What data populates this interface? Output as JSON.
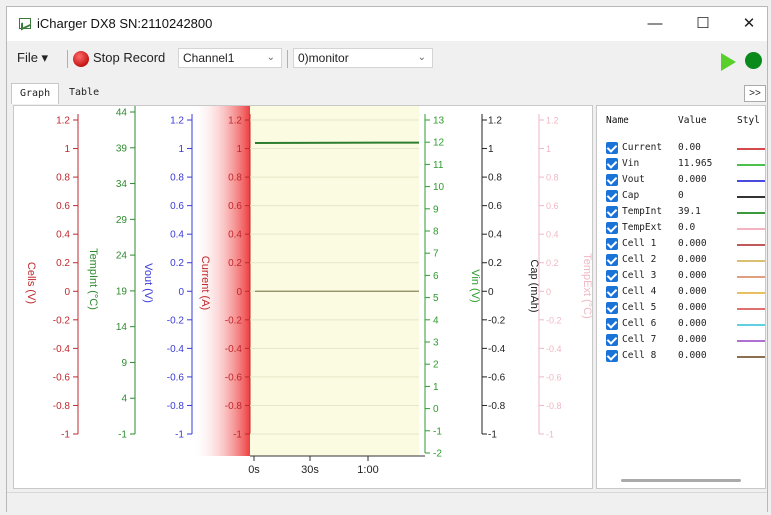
{
  "window": {
    "title": "iCharger DX8 SN:2110242800",
    "minimize_glyph": "—",
    "maximize_glyph": "☐",
    "close_glyph": "✕"
  },
  "toolbar": {
    "file_label": "File ▾",
    "stop_record_label": "Stop Record",
    "channel_value": "Channel1",
    "monitor_value": "0)monitor"
  },
  "tabs": [
    {
      "label": "Graph",
      "active": true
    },
    {
      "label": "Table",
      "active": false
    }
  ],
  "expand_label": ">>",
  "chart_data": {
    "type": "line",
    "x_ticks": [
      "0s",
      "30s",
      "1:00"
    ],
    "axes": [
      {
        "name": "cells",
        "label": "Cells (V)",
        "color": "#c0282d",
        "ticks": [
          "1.2",
          "1",
          "0.8",
          "0.6",
          "0.4",
          "0.2",
          "0",
          "-0.2",
          "-0.4",
          "-0.6",
          "-0.8",
          "-1"
        ]
      },
      {
        "name": "tempint",
        "label": "TempInt (°C)",
        "color": "#2f8a2f",
        "ticks": [
          "44",
          "39",
          "34",
          "29",
          "24",
          "19",
          "14",
          "9",
          "4",
          "-1"
        ]
      },
      {
        "name": "vout",
        "label": "Vout (V)",
        "color": "#3a3ad8",
        "ticks": [
          "1.2",
          "1",
          "0.8",
          "0.6",
          "0.4",
          "0.2",
          "0",
          "-0.2",
          "-0.4",
          "-0.6",
          "-0.8",
          "-1"
        ]
      },
      {
        "name": "current",
        "label": "Current (A)",
        "color": "#c0282d",
        "ticks": [
          "1.2",
          "1",
          "0.8",
          "0.6",
          "0.4",
          "0.2",
          "0",
          "-0.2",
          "-0.4",
          "-0.6",
          "-0.8",
          "-1"
        ]
      },
      {
        "name": "vin",
        "label": "Vin (V)",
        "color": "#2e9c2e",
        "ticks": [
          "13",
          "12",
          "11",
          "10",
          "9",
          "8",
          "7",
          "6",
          "5",
          "4",
          "3",
          "2",
          "1",
          "0",
          "-1",
          "-2"
        ]
      },
      {
        "name": "cap",
        "label": "Cap (mAh)",
        "color": "#222222",
        "ticks": [
          "1.2",
          "1",
          "0.8",
          "0.6",
          "0.4",
          "0.2",
          "0",
          "-0.2",
          "-0.4",
          "-0.6",
          "-0.8",
          "-1"
        ]
      },
      {
        "name": "tempext",
        "label": "TempExt (°C)",
        "color": "#f0b7c4",
        "ticks": [
          "1.2",
          "1",
          "0.8",
          "0.6",
          "0.4",
          "0.2",
          "0",
          "-0.2",
          "-0.4",
          "-0.6",
          "-0.8",
          "-1"
        ]
      }
    ],
    "series": [
      {
        "name": "Vin",
        "color": "#2e7d2e",
        "value": 11.965
      },
      {
        "name": "Current",
        "color": "#8a8a5a",
        "value": 0.0
      }
    ]
  },
  "panel": {
    "headers": [
      "Name",
      "Value",
      "Styl"
    ],
    "rows": [
      {
        "name": "Current",
        "value": "0.00",
        "color": "#d44a4a"
      },
      {
        "name": "Vin",
        "value": "11.965",
        "color": "#4cbf4c"
      },
      {
        "name": "Vout",
        "value": "0.000",
        "color": "#4a4ae0"
      },
      {
        "name": "Cap",
        "value": "0",
        "color": "#333333"
      },
      {
        "name": "TempInt",
        "value": "39.1",
        "color": "#3a9a3a"
      },
      {
        "name": "TempExt",
        "value": "0.0",
        "color": "#f2b4c2"
      },
      {
        "name": "Cell 1",
        "value": "0.000",
        "color": "#c05a5a"
      },
      {
        "name": "Cell 2",
        "value": "0.000",
        "color": "#d8c070"
      },
      {
        "name": "Cell 3",
        "value": "0.000",
        "color": "#e0a080"
      },
      {
        "name": "Cell 4",
        "value": "0.000",
        "color": "#e8c060"
      },
      {
        "name": "Cell 5",
        "value": "0.000",
        "color": "#e07070"
      },
      {
        "name": "Cell 6",
        "value": "0.000",
        "color": "#60d0e0"
      },
      {
        "name": "Cell 7",
        "value": "0.000",
        "color": "#b070d0"
      },
      {
        "name": "Cell 8",
        "value": "0.000",
        "color": "#8a7050"
      }
    ]
  }
}
